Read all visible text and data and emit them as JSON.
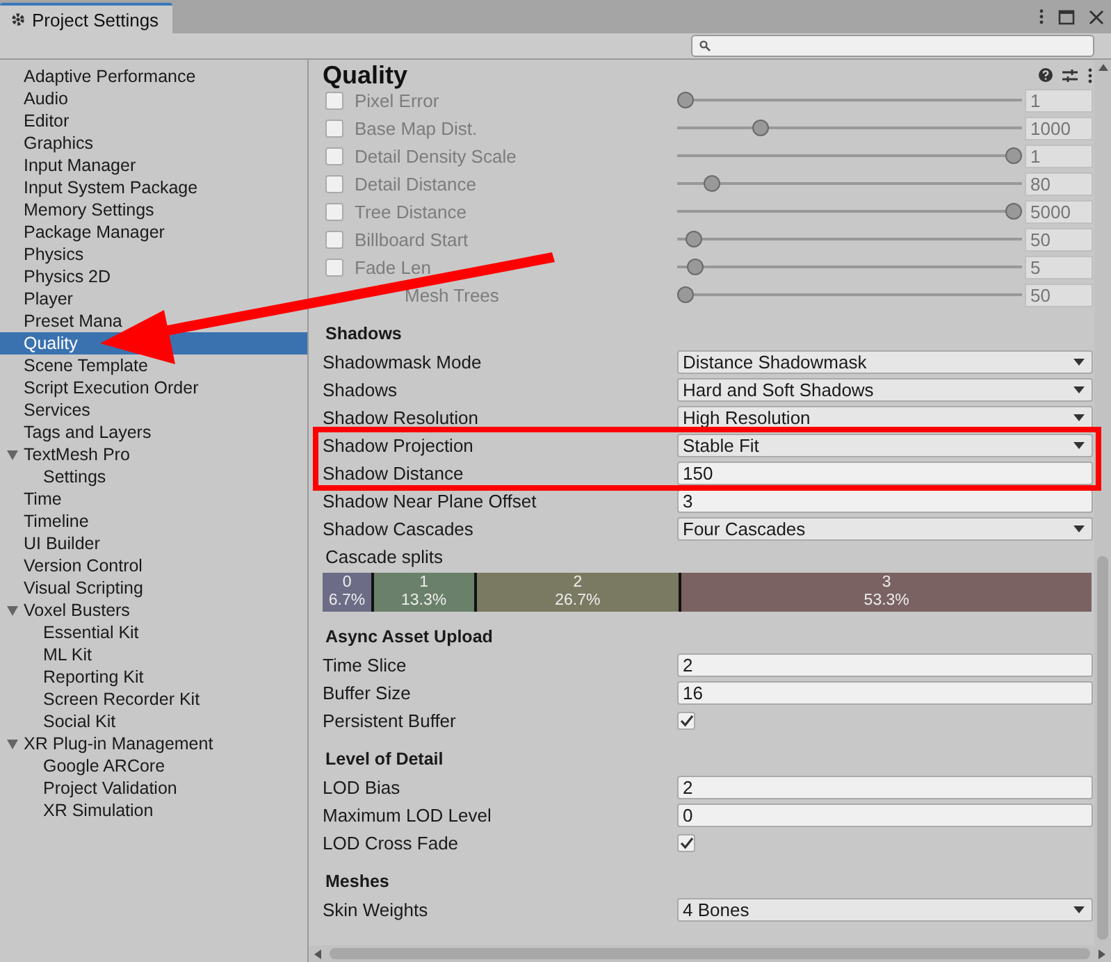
{
  "window": {
    "title": "Project Settings"
  },
  "sidebar": {
    "items": [
      {
        "label": "Adaptive Performance",
        "selected": false
      },
      {
        "label": "Audio",
        "selected": false
      },
      {
        "label": "Editor",
        "selected": false
      },
      {
        "label": "Graphics",
        "selected": false
      },
      {
        "label": "Input Manager",
        "selected": false
      },
      {
        "label": "Input System Package",
        "selected": false
      },
      {
        "label": "Memory Settings",
        "selected": false
      },
      {
        "label": "Package Manager",
        "selected": false
      },
      {
        "label": "Physics",
        "selected": false
      },
      {
        "label": "Physics 2D",
        "selected": false
      },
      {
        "label": "Player",
        "selected": false
      },
      {
        "label": "Preset Mana",
        "selected": false
      },
      {
        "label": "Quality",
        "selected": true
      },
      {
        "label": "Scene Template",
        "selected": false
      },
      {
        "label": "Script Execution Order",
        "selected": false
      },
      {
        "label": "Services",
        "selected": false
      },
      {
        "label": "Tags and Layers",
        "selected": false
      },
      {
        "label": "TextMesh Pro",
        "selected": false,
        "expanded": true,
        "children": [
          {
            "label": "Settings",
            "selected": false
          }
        ]
      },
      {
        "label": "Time",
        "selected": false
      },
      {
        "label": "Timeline",
        "selected": false
      },
      {
        "label": "UI Builder",
        "selected": false
      },
      {
        "label": "Version Control",
        "selected": false
      },
      {
        "label": "Visual Scripting",
        "selected": false
      },
      {
        "label": "Voxel Busters",
        "selected": false,
        "expanded": true,
        "children": [
          {
            "label": "Essential Kit",
            "selected": false
          },
          {
            "label": "ML Kit",
            "selected": false
          },
          {
            "label": "Reporting Kit",
            "selected": false
          },
          {
            "label": "Screen Recorder Kit",
            "selected": false
          },
          {
            "label": "Social Kit",
            "selected": false
          }
        ]
      },
      {
        "label": "XR Plug-in Management",
        "selected": false,
        "expanded": true,
        "children": [
          {
            "label": "Google ARCore",
            "selected": false
          },
          {
            "label": "Project Validation",
            "selected": false
          },
          {
            "label": "XR Simulation",
            "selected": false
          }
        ]
      }
    ]
  },
  "panel": {
    "title": "Quality",
    "sections": [
      {
        "rows": [
          {
            "kind": "slider",
            "label": "Pixel Error",
            "checked": false,
            "disabled": true,
            "level": 0,
            "value": "1"
          },
          {
            "kind": "slider",
            "label": "Base Map Dist.",
            "checked": false,
            "disabled": true,
            "level": 0.23,
            "value": "1000"
          },
          {
            "kind": "slider",
            "label": "Detail Density Scale",
            "checked": false,
            "disabled": true,
            "level": 1,
            "value": "1"
          },
          {
            "kind": "slider",
            "label": "Detail Distance",
            "checked": false,
            "disabled": true,
            "level": 0.08,
            "value": "80"
          },
          {
            "kind": "slider",
            "label": "Tree Distance",
            "checked": false,
            "disabled": true,
            "level": 1,
            "value": "5000"
          },
          {
            "kind": "slider",
            "label": "Billboard Start",
            "checked": false,
            "disabled": true,
            "level": 0.025,
            "value": "50"
          },
          {
            "kind": "slider",
            "label": "Fade Len",
            "checked": false,
            "disabled": true,
            "level": 0.03,
            "value": "5"
          },
          {
            "kind": "slider",
            "label": "Mesh Trees",
            "disabled": true,
            "level": 0,
            "value": "50"
          }
        ]
      },
      {
        "heading": "Shadows",
        "rows": [
          {
            "kind": "dropdown",
            "label": "Shadowmask Mode",
            "value": "Distance Shadowmask"
          },
          {
            "kind": "dropdown",
            "label": "Shadows",
            "value": "Hard and Soft Shadows"
          },
          {
            "kind": "dropdown",
            "label": "Shadow Resolution",
            "value": "High Resolution"
          },
          {
            "kind": "dropdown",
            "label": "Shadow Projection",
            "value": "Stable Fit"
          },
          {
            "kind": "field",
            "label": "Shadow Distance",
            "value": "150"
          },
          {
            "kind": "field",
            "label": "Shadow Near Plane Offset",
            "value": "3"
          },
          {
            "kind": "dropdown",
            "label": "Shadow Cascades",
            "value": "Four Cascades"
          },
          {
            "kind": "cascades",
            "label": "Cascade splits",
            "segments": [
              {
                "index": "0",
                "percent": "6.7%",
                "level": 0.067,
                "color": "#6c6c86"
              },
              {
                "index": "1",
                "percent": "13.3%",
                "level": 0.133,
                "color": "#6a806a"
              },
              {
                "index": "2",
                "percent": "26.7%",
                "level": 0.267,
                "color": "#7a7a62"
              },
              {
                "index": "3",
                "percent": "53.3%",
                "level": 0.533,
                "color": "#7a6262"
              }
            ]
          }
        ]
      },
      {
        "heading": "Async Asset Upload",
        "rows": [
          {
            "kind": "field",
            "label": "Time Slice",
            "value": "2"
          },
          {
            "kind": "field",
            "label": "Buffer Size",
            "value": "16"
          },
          {
            "kind": "toggle",
            "label": "Persistent Buffer",
            "checked": true
          }
        ]
      },
      {
        "heading": "Level of Detail",
        "rows": [
          {
            "kind": "field",
            "label": "LOD Bias",
            "value": "2"
          },
          {
            "kind": "field",
            "label": "Maximum LOD Level",
            "value": "0"
          },
          {
            "kind": "toggle",
            "label": "LOD Cross Fade",
            "checked": true
          }
        ]
      },
      {
        "heading": "Meshes",
        "rows": [
          {
            "kind": "dropdown",
            "label": "Skin Weights",
            "value": "4 Bones"
          }
        ]
      }
    ]
  }
}
